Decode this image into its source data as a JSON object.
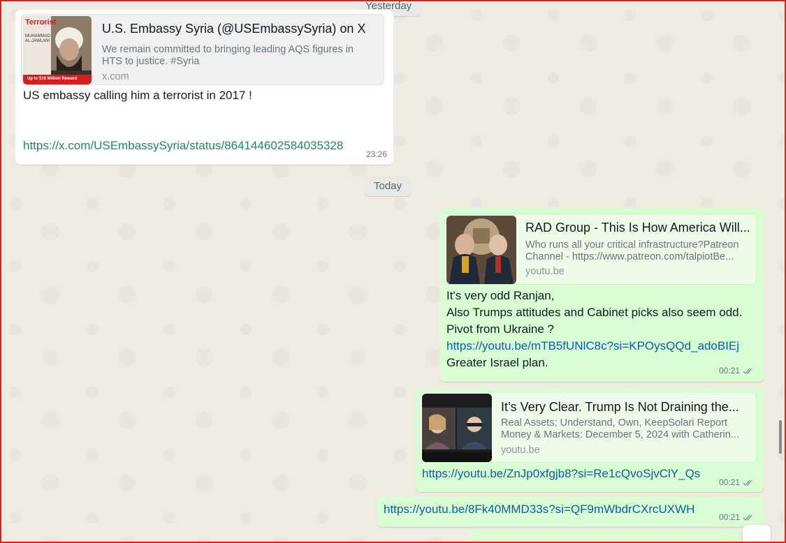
{
  "dates": {
    "yesterday": "Yesterday",
    "today": "Today"
  },
  "messages": [
    {
      "direction": "in",
      "preview": {
        "title": "U.S. Embassy Syria (@USEmbassySyria) on X",
        "description": "We remain committed to bringing leading AQS figures in HTS to justice. #Syria",
        "domain": "x.com",
        "thumb_label": "Terrorist",
        "thumb_name": "MUHAMMAD AL-JAWLANI",
        "thumb_reward": "Up to $10 Million Reward"
      },
      "text": "US embassy calling him a terrorist in 2017 !",
      "link": "https://x.com/USEmbassySyria/status/864144602584035328",
      "time": "23:26"
    },
    {
      "direction": "out",
      "preview": {
        "title": "RAD Group - This Is How America Will...",
        "description_line1": "Who runs all your critical infrastructure?Patreon",
        "description_line2": "Channel - https://www.patreon.com/talpiotBe...",
        "domain": "youtu.be"
      },
      "lines": [
        "It's very odd Ranjan,",
        "Also Trumps attitudes and Cabinet picks also seem odd.",
        "Pivot from Ukraine ?"
      ],
      "link": "https://youtu.be/mTB5fUNlC8c?si=KPOysQQd_adoBIEj",
      "after_link": "Greater Israel plan.",
      "time": "00:21"
    },
    {
      "direction": "out",
      "preview": {
        "title": "It’s Very Clear. Trump Is Not Draining the...",
        "description_line1": "Real Assets: Understand, Own, KeepSolari Report",
        "description_line2": "Money & Markets: December 5, 2024 with Catherin...",
        "domain": "youtu.be"
      },
      "link": "https://youtu.be/ZnJp0xfgjb8?si=Re1cQvoSjvClY_Qs",
      "time": "00:21"
    },
    {
      "direction": "out",
      "link": "https://youtu.be/8Fk40MMD33s?si=QF9mWbdrCXrcUXWH",
      "time": "00:21"
    }
  ],
  "colors": {
    "chat_bg": "#efeae2",
    "incoming_bubble": "#ffffff",
    "outgoing_bubble": "#d9fdd3",
    "incoming_link": "#1b8a5a",
    "outgoing_link": "#0a5fa3",
    "frame_border": "#e0201a"
  }
}
